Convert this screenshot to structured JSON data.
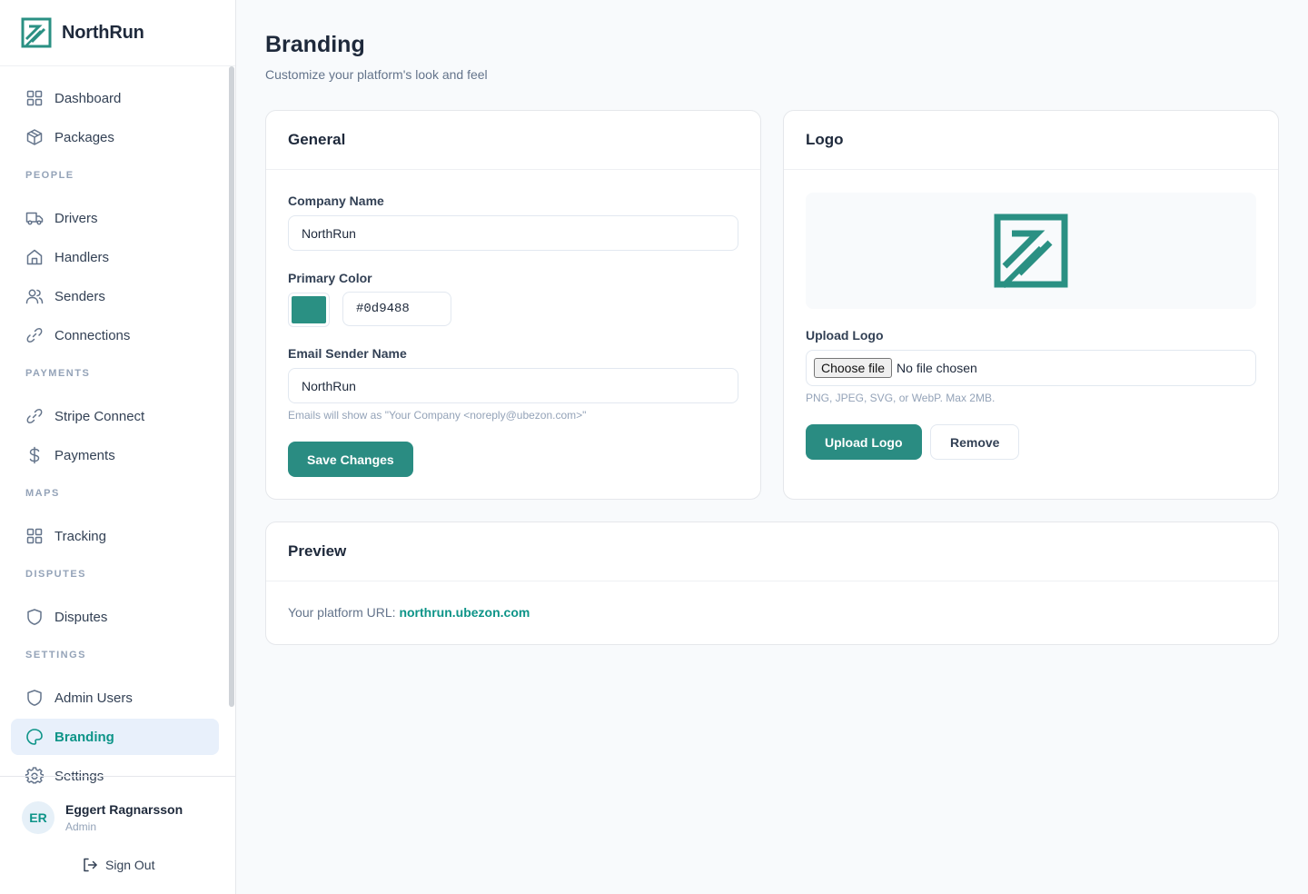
{
  "brand": {
    "name": "NorthRun"
  },
  "sidebar": {
    "sections": [
      {
        "label": "",
        "items": [
          {
            "label": "Dashboard",
            "icon": "grid-icon"
          },
          {
            "label": "Packages",
            "icon": "package-icon"
          }
        ]
      },
      {
        "label": "PEOPLE",
        "items": [
          {
            "label": "Drivers",
            "icon": "truck-icon"
          },
          {
            "label": "Handlers",
            "icon": "home-icon"
          },
          {
            "label": "Senders",
            "icon": "users-icon"
          },
          {
            "label": "Connections",
            "icon": "link-icon"
          }
        ]
      },
      {
        "label": "PAYMENTS",
        "items": [
          {
            "label": "Stripe Connect",
            "icon": "link-icon"
          },
          {
            "label": "Payments",
            "icon": "dollar-icon"
          }
        ]
      },
      {
        "label": "MAPS",
        "items": [
          {
            "label": "Tracking",
            "icon": "grid-icon"
          }
        ]
      },
      {
        "label": "DISPUTES",
        "items": [
          {
            "label": "Disputes",
            "icon": "shield-icon"
          }
        ]
      },
      {
        "label": "SETTINGS",
        "items": [
          {
            "label": "Admin Users",
            "icon": "shield-icon"
          },
          {
            "label": "Branding",
            "icon": "palette-icon",
            "active": true
          },
          {
            "label": "Settings",
            "icon": "gear-icon"
          }
        ]
      }
    ]
  },
  "user": {
    "initials": "ER",
    "name": "Eggert Ragnarsson",
    "role": "Admin",
    "sign_out": "Sign Out"
  },
  "page": {
    "title": "Branding",
    "subtitle": "Customize your platform's look and feel"
  },
  "general": {
    "title": "General",
    "company_label": "Company Name",
    "company_value": "NorthRun",
    "color_label": "Primary Color",
    "color_value": "#0d9488",
    "sender_label": "Email Sender Name",
    "sender_value": "NorthRun",
    "sender_hint": "Emails will show as \"Your Company <noreply@ubezon.com>\"",
    "save_label": "Save Changes"
  },
  "logo": {
    "title": "Logo",
    "upload_label": "Upload Logo",
    "choose_file": "Choose file",
    "no_file": "No file chosen",
    "hint": "PNG, JPEG, SVG, or WebP. Max 2MB.",
    "upload_button": "Upload Logo",
    "remove_button": "Remove"
  },
  "preview": {
    "title": "Preview",
    "url_prefix": "Your platform URL:",
    "url": "northrun.ubezon.com"
  },
  "colors": {
    "accent": "#0d9488",
    "button": "#2a8c82",
    "logo": "#2a9083"
  }
}
